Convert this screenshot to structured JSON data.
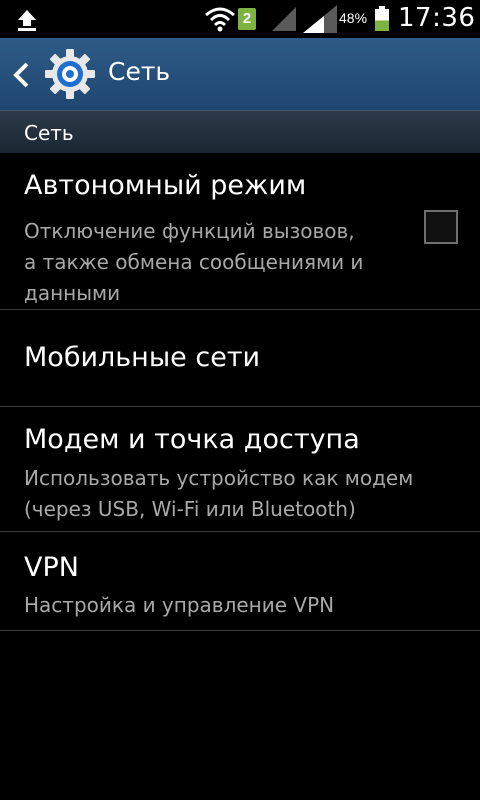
{
  "status_bar": {
    "icons": [
      "upload-icon",
      "wifi-icon",
      "sim-badge-icon",
      "signal-icon",
      "signal-icon",
      "battery-icon"
    ],
    "sim_badge": "2",
    "battery_percent": "48%",
    "time": "17:36",
    "battery_level": 0.48
  },
  "action_bar": {
    "title": "Сеть",
    "icons": [
      "back-arrow-icon",
      "settings-gear-icon"
    ]
  },
  "section": {
    "label": "Сеть"
  },
  "settings": [
    {
      "title": "Автономный режим",
      "summary_lines": [
        "Отключение функций вызовов,",
        "а также обмена сообщениями и",
        "данными"
      ],
      "checkbox_checked": false
    },
    {
      "title": "Мобильные сети"
    },
    {
      "title": "Модем и точка доступа",
      "summary_lines": [
        "Использовать устройство как модем",
        "(через USB, Wi-Fi или Bluetooth)"
      ]
    },
    {
      "title": "VPN",
      "summary_lines": [
        "Настройка и управление VPN"
      ]
    }
  ],
  "colors": {
    "action_bar": "#2d5b86",
    "sim_badge": "#7cb342",
    "battery_fill": "#7cb342"
  }
}
